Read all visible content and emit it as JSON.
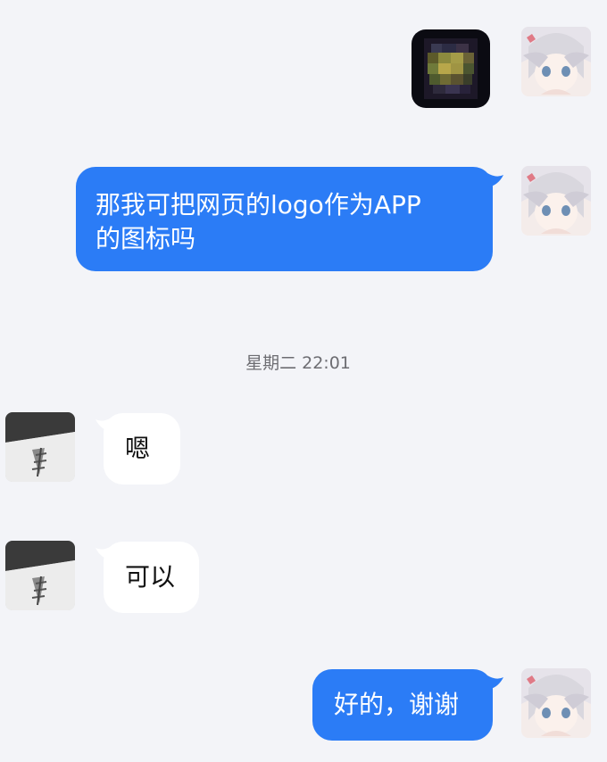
{
  "conversation": {
    "messages": [
      {
        "type": "image",
        "direction": "out"
      },
      {
        "type": "text",
        "direction": "out",
        "text_line1": "那我可把网页的logo作为APP",
        "text_line2": "的图标吗"
      },
      {
        "type": "text",
        "direction": "in",
        "text": "嗯"
      },
      {
        "type": "text",
        "direction": "in",
        "text": "可以"
      },
      {
        "type": "text",
        "direction": "out",
        "text": "好的，谢谢"
      }
    ],
    "timestamp": "星期二 22:01"
  },
  "colors": {
    "background": "#f3f4f8",
    "outgoing_bubble": "#2b7cf6",
    "incoming_bubble": "#ffffff",
    "timestamp_text": "#6d6d72"
  },
  "icons": {
    "self_avatar": "anime-girl-avatar",
    "other_avatar": "sketch-photo-avatar",
    "image_message": "pixelated-game-icon"
  }
}
